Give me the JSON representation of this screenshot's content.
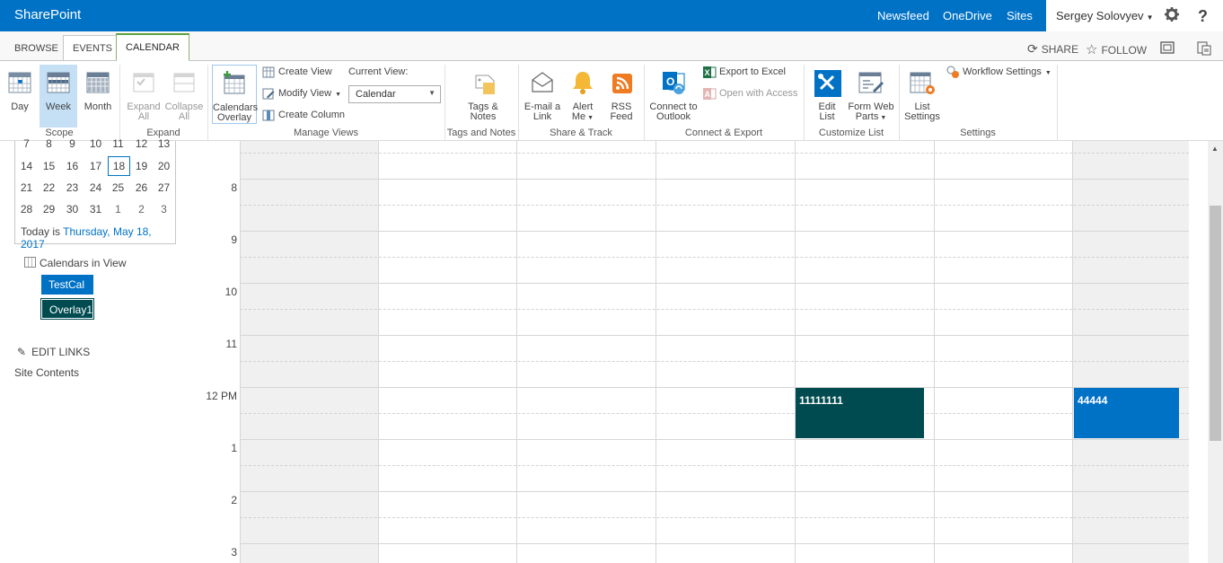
{
  "suite": {
    "brand": "SharePoint",
    "links": [
      "Newsfeed",
      "OneDrive",
      "Sites"
    ],
    "user": "Sergey Solovyev",
    "settings_icon": "gear-icon",
    "help": "?"
  },
  "tabs": [
    "BROWSE",
    "EVENTS",
    "CALENDAR"
  ],
  "promoted": {
    "share": "SHARE",
    "follow": "FOLLOW"
  },
  "ribbon": {
    "scope": {
      "day": "Day",
      "week": "Week",
      "month": "Month",
      "label": "Scope"
    },
    "expand": {
      "expand_all_1": "Expand",
      "expand_all_2": "All",
      "collapse_all_1": "Collapse",
      "collapse_all_2": "All",
      "label": "Expand"
    },
    "manage_views": {
      "overlay_1": "Calendars",
      "overlay_2": "Overlay",
      "create_view": "Create View",
      "modify_view": "Modify View",
      "create_column": "Create Column",
      "current_view_label": "Current View:",
      "current_view_value": "Calendar",
      "label": "Manage Views"
    },
    "tags": {
      "btn_1": "Tags &",
      "btn_2": "Notes",
      "label": "Tags and Notes"
    },
    "share_track": {
      "email_1": "E-mail a",
      "email_2": "Link",
      "alert_1": "Alert",
      "alert_2": "Me",
      "rss_1": "RSS",
      "rss_2": "Feed",
      "label": "Share & Track"
    },
    "connect": {
      "outlook_1": "Connect to",
      "outlook_2": "Outlook",
      "excel": "Export to Excel",
      "access": "Open with Access",
      "label": "Connect & Export"
    },
    "customize": {
      "edit_1": "Edit",
      "edit_2": "List",
      "form_1": "Form Web",
      "form_2": "Parts",
      "label": "Customize List"
    },
    "settings": {
      "list_1": "List",
      "list_2": "Settings",
      "workflow": "Workflow Settings",
      "label": "Settings"
    }
  },
  "minical": {
    "rows": [
      [
        "7",
        "8",
        "9",
        "10",
        "11",
        "12",
        "13"
      ],
      [
        "14",
        "15",
        "16",
        "17",
        "18",
        "19",
        "20"
      ],
      [
        "21",
        "22",
        "23",
        "24",
        "25",
        "26",
        "27"
      ],
      [
        "28",
        "29",
        "30",
        "31",
        "1",
        "2",
        "3"
      ]
    ],
    "today_prefix": "Today is",
    "today_date": "Thursday, May 18, 2017"
  },
  "calendars_in_view": {
    "title": "Calendars in View",
    "items": [
      {
        "name": "TestCal",
        "color": "#0072c6"
      },
      {
        "name": "Overlay1",
        "color": "#004b50"
      }
    ]
  },
  "nav": {
    "edit_links": "EDIT LINKS",
    "site_contents": "Site Contents"
  },
  "week_grid": {
    "hours": [
      "8",
      "9",
      "10",
      "11",
      "12 PM",
      "1",
      "2",
      "3"
    ],
    "events": [
      {
        "title": "11111111",
        "color": "#004b50"
      },
      {
        "title": "44444",
        "color": "#0072c6"
      }
    ]
  }
}
